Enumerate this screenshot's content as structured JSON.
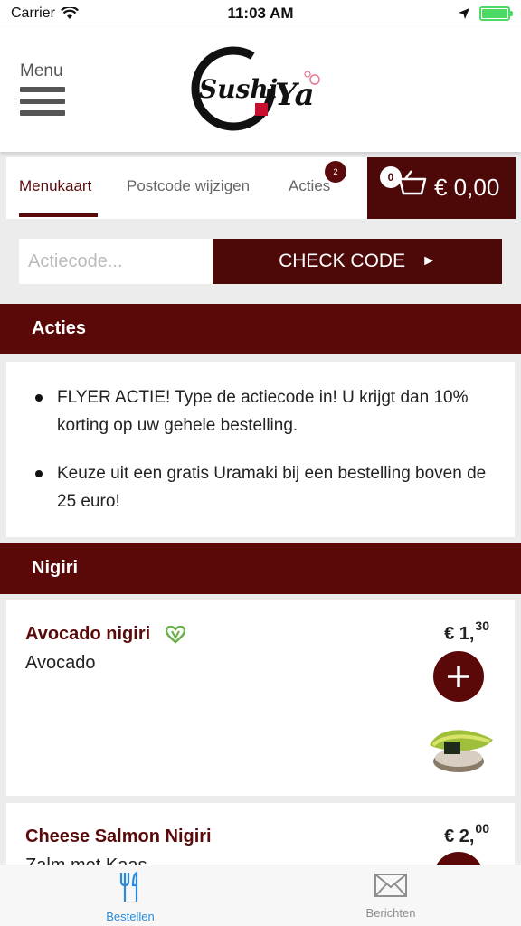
{
  "status_bar": {
    "carrier": "Carrier",
    "time": "11:03 AM"
  },
  "header": {
    "menu_label": "Menu",
    "logo_text_left": "Sushi",
    "logo_text_right": "Ya"
  },
  "nav_tabs": [
    {
      "label": "Menukaart",
      "active": true
    },
    {
      "label": "Postcode wijzigen",
      "active": false
    },
    {
      "label": "Acties",
      "active": false,
      "badge": "2"
    }
  ],
  "cart": {
    "count": "0",
    "total": "€ 0,00"
  },
  "action_code": {
    "placeholder": "Actiecode...",
    "button_label": "CHECK CODE",
    "button_arrow": "►"
  },
  "sections": {
    "acties": "Acties",
    "nigiri": "Nigiri"
  },
  "acties_items": [
    "FLYER ACTIE! Type de actiecode in! U krijgt dan 10% korting op uw gehele bestelling.",
    "Keuze uit een gratis Uramaki bij een bestelling boven de 25 euro!"
  ],
  "products": [
    {
      "name": "Avocado nigiri",
      "description": "Avocado",
      "price_main": "€ 1,",
      "price_cents": "30",
      "vegetarian": true
    },
    {
      "name": "Cheese Salmon Nigiri",
      "description": "Zalm met Kaas",
      "price_main": "€ 2,",
      "price_cents": "00",
      "vegetarian": false
    }
  ],
  "bottom_tabs": [
    {
      "label": "Bestellen",
      "icon": "cutlery-icon",
      "active": true
    },
    {
      "label": "Berichten",
      "icon": "envelope-icon",
      "active": false
    }
  ],
  "colors": {
    "primary": "#5a0808",
    "active_tab": "#2b8ad8",
    "veg": "#6ab04c"
  }
}
